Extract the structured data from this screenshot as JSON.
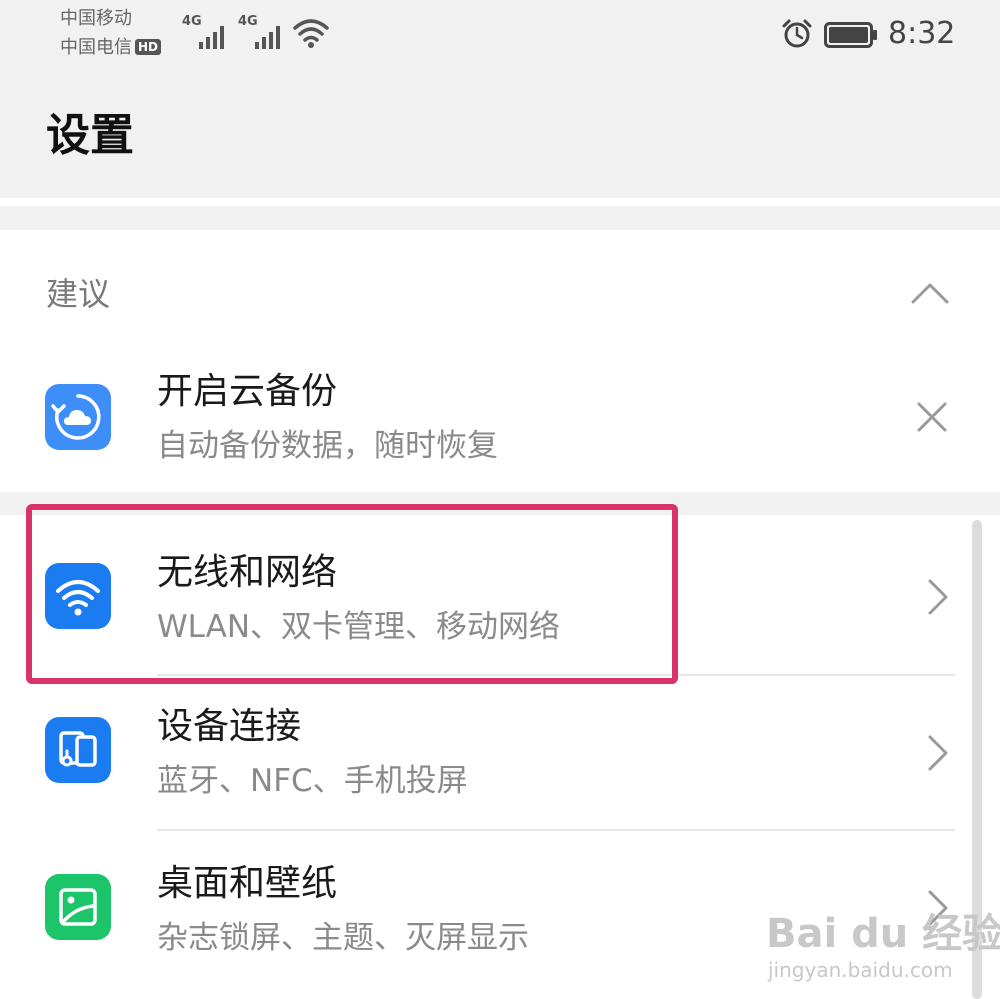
{
  "status_bar": {
    "carrier_1": "中国移动",
    "carrier_2": "中国电信",
    "hd_badge": "HD",
    "network_1": "4G",
    "network_2": "4G",
    "time": "8:32",
    "icons": [
      "signal-icon",
      "signal-icon",
      "wifi-icon",
      "alarm-icon",
      "battery-icon"
    ]
  },
  "header": {
    "title": "设置"
  },
  "suggestions": {
    "header": "建议",
    "item": {
      "title": "开启云备份",
      "subtitle": "自动备份数据，随时恢复",
      "icon": "cloud-backup-icon",
      "icon_color": "#3d8ef8"
    }
  },
  "settings_items": [
    {
      "title": "无线和网络",
      "subtitle": "WLAN、双卡管理、移动网络",
      "icon": "wifi-settings-icon",
      "icon_color": "#1a7cf0"
    },
    {
      "title": "设备连接",
      "subtitle": "蓝牙、NFC、手机投屏",
      "icon": "device-connection-icon",
      "icon_color": "#1a7cf0"
    },
    {
      "title": "桌面和壁纸",
      "subtitle": "杂志锁屏、主题、灭屏显示",
      "icon": "wallpaper-icon",
      "icon_color": "#1cc46a"
    }
  ],
  "highlight_color": "#d9336e",
  "watermark": {
    "brand": "Bai du 经验",
    "url": "jingyan.baidu.com"
  }
}
